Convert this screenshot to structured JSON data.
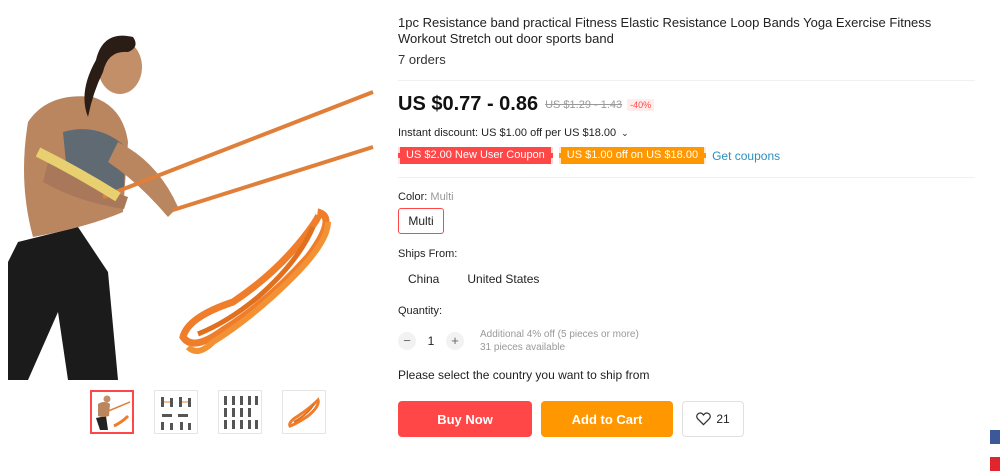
{
  "product": {
    "title": "1pc Resistance band practical Fitness Elastic Resistance Loop Bands Yoga Exercise Fitness Workout Stretch out door sports band",
    "orders": "7 orders"
  },
  "price": {
    "current": "US $0.77 - 0.86",
    "original": "US $1.29 - 1.43",
    "discount": "-40%"
  },
  "instant_discount": "Instant discount: US $1.00 off per US $18.00",
  "coupons": {
    "new_user": "US $2.00 New User Coupon",
    "store": "US $1.00 off on US $18.00",
    "get_label": "Get coupons"
  },
  "color": {
    "label": "Color:",
    "selected": "Multi",
    "options": [
      "Multi"
    ]
  },
  "ships_from": {
    "label": "Ships From:",
    "options": [
      "China",
      "United States"
    ]
  },
  "quantity": {
    "label": "Quantity:",
    "value": "1",
    "minus": "−",
    "plus": "+",
    "note": "Additional 4% off (5 pieces or more)",
    "available": "31 pieces available"
  },
  "shipping_message": "Please select the country you want to ship from",
  "actions": {
    "buy_now": "Buy Now",
    "add_to_cart": "Add to Cart",
    "wishlist_count": "21"
  },
  "icons": {
    "chevron": "chevron-down-icon",
    "heart": "heart-icon"
  },
  "colors": {
    "accent_red": "#ff4747",
    "accent_orange": "#ff9800",
    "link_blue": "#2a8fbd"
  }
}
